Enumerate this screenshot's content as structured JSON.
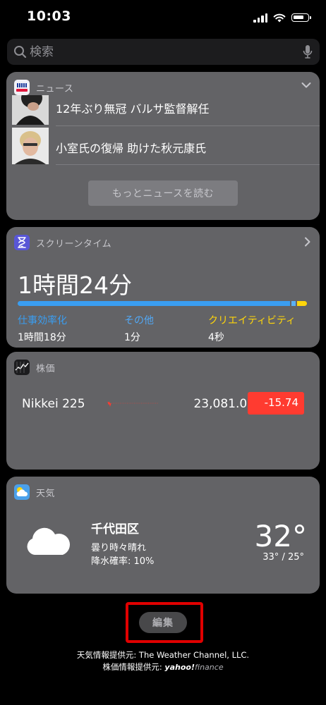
{
  "status_bar": {
    "time": "10:03"
  },
  "search": {
    "placeholder": "検索"
  },
  "news_widget": {
    "title": "ニュース",
    "headlines": [
      "12年ぶり無冠 バルサ監督解任",
      "小室氏の復帰 助けた秋元康氏"
    ],
    "more_button": "もっとニュースを読む"
  },
  "screen_time_widget": {
    "title": "スクリーンタイム",
    "total": "1時間24分",
    "categories": [
      {
        "name": "仕事効率化",
        "time": "1時間18分",
        "color": "#3a9df0"
      },
      {
        "name": "その他",
        "time": "1分",
        "color": "#52a8f5"
      },
      {
        "name": "クリエイティビティ",
        "time": "4秒",
        "color": "#ffd60a"
      }
    ]
  },
  "stocks_widget": {
    "title": "株価",
    "symbol": "Nikkei 225",
    "price": "23,081.01",
    "change": "-15.74",
    "change_color": "#ff3b30"
  },
  "weather_widget": {
    "title": "天気",
    "location": "千代田区",
    "condition": "曇り時々晴れ",
    "precipitation": "降水確率: 10%",
    "temperature": "32°",
    "high_low": "33° / 25°"
  },
  "edit_button": "編集",
  "footer": {
    "weather_provider": "天気情報提供元: The Weather Channel, LLC.",
    "stocks_provider_label": "株価情報提供元:",
    "stocks_provider_brand": "yahoo!",
    "stocks_provider_suffix": "finance"
  },
  "icons": [
    "search-icon",
    "mic-icon",
    "chevron-down-icon",
    "chevron-right-icon",
    "cloud-icon",
    "hourglass-icon",
    "stocks-chart-icon",
    "weather-app-icon",
    "news-app-icon"
  ]
}
